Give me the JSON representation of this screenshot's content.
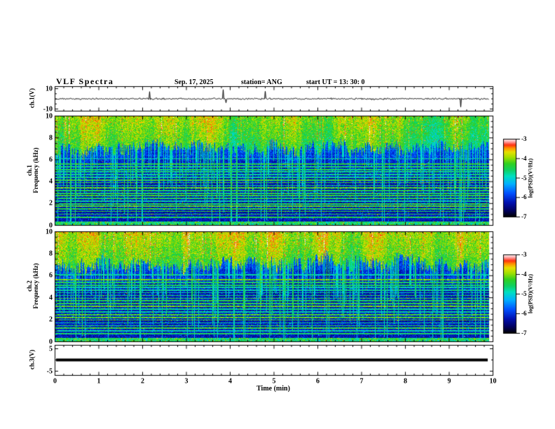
{
  "header": {
    "title": "VLF Spectra",
    "date": "Sep. 17, 2025",
    "station": "station= ANG",
    "start_ut": "start UT  =   13: 30: 0"
  },
  "panels": {
    "ch1_wave": {
      "ylabel": "ch.1(V)",
      "ytick_values": [
        10,
        -10
      ],
      "ytick_labels": [
        "10",
        "-10"
      ]
    },
    "spec1": {
      "ylabel_line1": "ch.1",
      "ylabel_line2": "Frequency (kHz)"
    },
    "spec2": {
      "ylabel_line1": "ch.2",
      "ylabel_line2": "Frequency (kHz)"
    },
    "ch3": {
      "ylabel": "ch.3(V)",
      "ytick_values": [
        5,
        -5
      ],
      "ytick_labels": [
        "5",
        "-5"
      ]
    }
  },
  "xaxis": {
    "label": "Time (min)",
    "ticks": [
      0,
      1,
      2,
      3,
      4,
      5,
      6,
      7,
      8,
      9,
      10
    ],
    "minor_step": 0.2,
    "range": [
      0,
      10
    ]
  },
  "freq_axis": {
    "ticks": [
      0,
      2,
      4,
      6,
      8,
      10
    ],
    "minor_step": 0.5,
    "range": [
      0,
      10
    ]
  },
  "colorbar": {
    "label": "log(PSD)(V²/Hz)",
    "ticks": [
      -3,
      -4,
      -5,
      -6,
      -7
    ],
    "range_low": -7,
    "range_high": -3
  },
  "colormap_stops": [
    [
      0.0,
      "#000005"
    ],
    [
      0.08,
      "#000060"
    ],
    [
      0.18,
      "#0010b0"
    ],
    [
      0.3,
      "#0050ff"
    ],
    [
      0.42,
      "#00b0ff"
    ],
    [
      0.52,
      "#00e0c0"
    ],
    [
      0.6,
      "#10d060"
    ],
    [
      0.68,
      "#30d020"
    ],
    [
      0.76,
      "#a0e000"
    ],
    [
      0.83,
      "#e8e000"
    ],
    [
      0.88,
      "#ff9000"
    ],
    [
      0.92,
      "#ff3010"
    ],
    [
      0.96,
      "#ffa0a0"
    ],
    [
      1.0,
      "#ffffff"
    ]
  ],
  "chart_data": [
    {
      "type": "line",
      "name": "ch1_waveform",
      "ylabel": "ch.1(V)",
      "ylim": [
        -10,
        10
      ],
      "xlim": [
        0,
        10
      ],
      "x_units": "min",
      "description": "black broadband noise trace centred on 0 V, typical amplitude under 2 V with sporadic spikes to about ±9 V",
      "render": {
        "seed": 20250917,
        "sigma_v": 0.75,
        "spike_probability": 0.012,
        "spike_v": [
          3,
          9
        ]
      }
    },
    {
      "type": "heatmap",
      "name": "ch1_spectrogram",
      "xlabel": "Time (min)",
      "ylabel": "Frequency (kHz)",
      "xlim": [
        0,
        10
      ],
      "ylim": [
        0,
        10
      ],
      "clim": [
        -7,
        -3
      ],
      "clabel": "log(PSD)(V²/Hz)",
      "features": "strong broadband power above ~7 kHz (green/yellow with red bursts), vertical sferic streaks reaching down to 0 kHz, dark navy background below 7 kHz, many narrow horizontal interference lines 0.7-6.1 kHz, green noise band below 0.3 kHz",
      "render": {
        "seed": 11,
        "transition_khz": 7.1,
        "transition_jitter": 1.0,
        "top_base_t": 0.66,
        "bottom_base_t": 0.19,
        "streak_probability": 0.1,
        "weak_streak_probability": 0.18,
        "red_speckle_probability": 0.02,
        "bottom_band_khz": 0.33,
        "line_freqs_khz": [
          0.7,
          1.0,
          1.25,
          1.5,
          1.75,
          1.95,
          2.2,
          2.45,
          2.7,
          2.9,
          3.15,
          3.4,
          3.65,
          3.9,
          4.15,
          4.4,
          4.65,
          4.9,
          5.1,
          5.35,
          5.6,
          6.1
        ]
      }
    },
    {
      "type": "heatmap",
      "name": "ch2_spectrogram",
      "xlabel": "Time (min)",
      "ylabel": "Frequency (kHz)",
      "xlim": [
        0,
        10
      ],
      "ylim": [
        0,
        10
      ],
      "clim": [
        -7,
        -3
      ],
      "clabel": "log(PSD)(V²/Hz)",
      "features": "same structure as ch.1 but slightly hotter top band (more yellow/orange above 7 kHz)",
      "render": {
        "seed": 77,
        "transition_khz": 7.0,
        "transition_jitter": 1.1,
        "top_base_t": 0.7,
        "bottom_base_t": 0.19,
        "streak_probability": 0.11,
        "weak_streak_probability": 0.18,
        "red_speckle_probability": 0.03,
        "bottom_band_khz": 0.33,
        "line_freqs_khz": [
          0.7,
          0.95,
          1.2,
          1.45,
          1.7,
          1.95,
          2.2,
          2.45,
          2.7,
          2.95,
          3.2,
          3.45,
          3.7,
          3.95,
          4.2,
          4.45,
          4.7,
          4.95,
          5.15,
          5.4,
          5.65,
          6.1
        ]
      }
    },
    {
      "type": "line",
      "name": "ch3_waveform",
      "ylabel": "ch.3(V)",
      "ylim": [
        -5,
        5
      ],
      "xlim": [
        0,
        10
      ],
      "description": "flat thick black line at 0 V (no signal)",
      "value": 0
    }
  ]
}
